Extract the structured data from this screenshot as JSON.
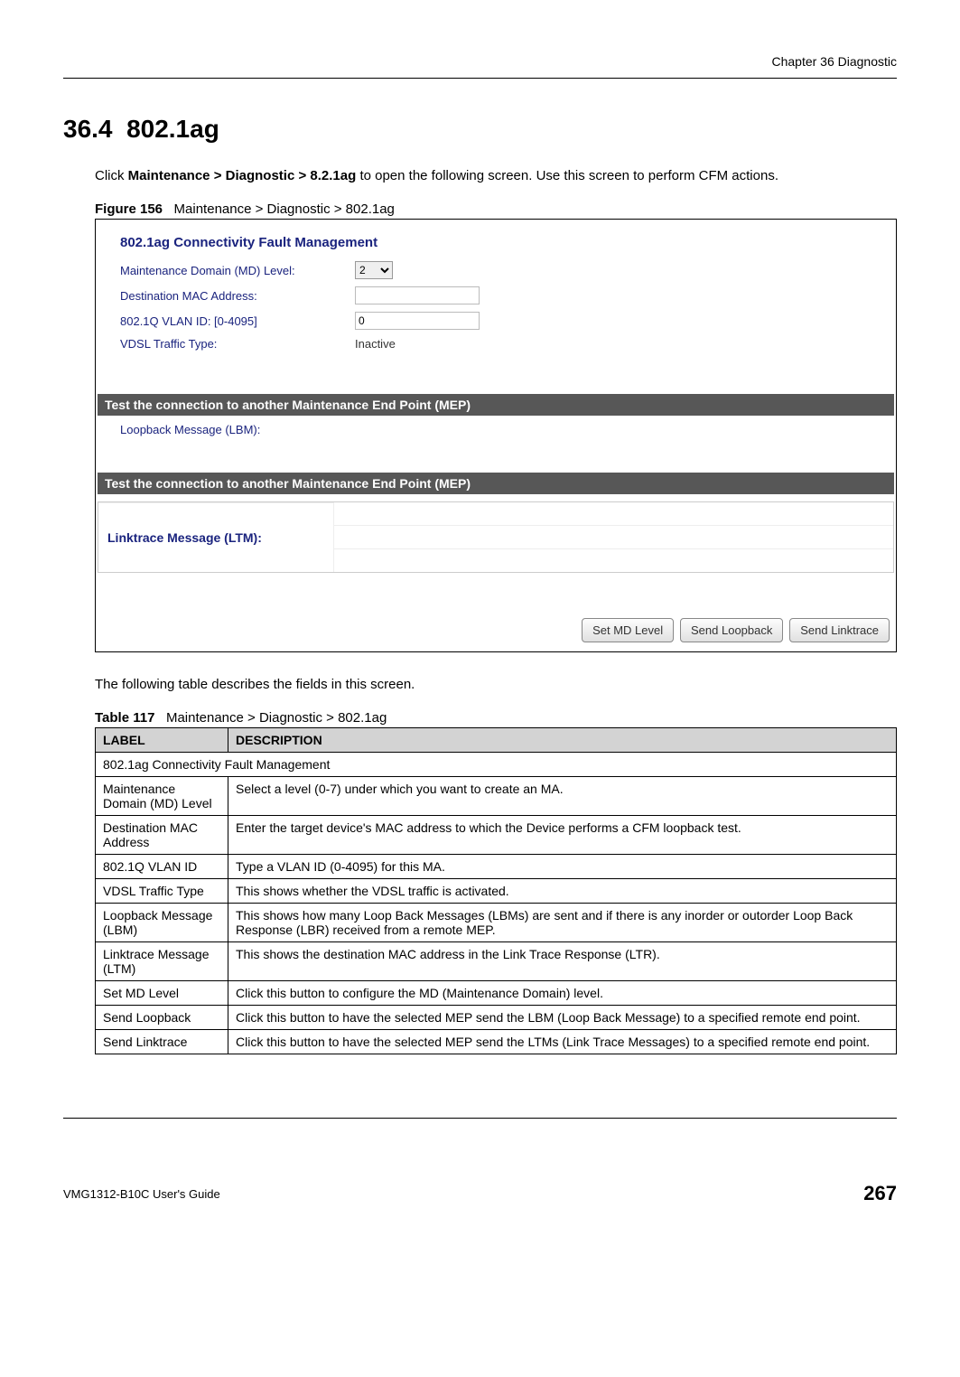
{
  "header": {
    "chapter": "Chapter 36 Diagnostic"
  },
  "section": {
    "number": "36.4",
    "title": "802.1ag"
  },
  "intro": {
    "prefix": "Click ",
    "path1": "Maintenance > ",
    "path2": "Diagnostic",
    "path3": " > 8.2.1ag",
    "suffix": " to open the following screen. Use this screen to perform CFM actions."
  },
  "figure": {
    "label": "Figure 156",
    "caption": "Maintenance > Diagnostic > 802.1ag"
  },
  "screenshot": {
    "panel_title": "802.1ag Connectivity Fault Management",
    "md_level_label": "Maintenance Domain (MD) Level:",
    "md_level_value": "2",
    "dest_mac_label": "Destination MAC Address:",
    "dest_mac_value": "",
    "vlan_label": "802.1Q VLAN ID: [0-4095]",
    "vlan_value": "0",
    "vdsl_label": "VDSL Traffic Type:",
    "vdsl_value": "Inactive",
    "banner1": "Test the connection to another Maintenance End Point (MEP)",
    "lbm_label": "Loopback Message (LBM):",
    "banner2": "Test the connection to another Maintenance End Point (MEP)",
    "ltm_label": "Linktrace Message (LTM):",
    "btn_md": "Set MD Level",
    "btn_loopback": "Send Loopback",
    "btn_linktrace": "Send Linktrace"
  },
  "post_figure_text": "The following table describes the fields in this screen.",
  "table": {
    "label": "Table 117",
    "caption": "Maintenance > Diagnostic > 802.1ag",
    "header_label": "LABEL",
    "header_desc": "DESCRIPTION",
    "rows": [
      {
        "label": "802.1ag Connectivity Fault Management",
        "desc": "",
        "span": true
      },
      {
        "label": "Maintenance Domain (MD) Level",
        "desc": "Select a level (0-7) under which you want to create an MA."
      },
      {
        "label": "Destination MAC Address",
        "desc": "Enter the target device's MAC address to which the Device performs a CFM loopback test."
      },
      {
        "label": "802.1Q VLAN ID",
        "desc": "Type a VLAN ID (0-4095) for this MA."
      },
      {
        "label": "VDSL Traffic Type",
        "desc": "This shows whether the VDSL traffic is activated."
      },
      {
        "label": "Loopback Message (LBM)",
        "desc": "This shows how many Loop Back Messages (LBMs) are sent and if there is any inorder or outorder Loop Back Response (LBR) received from a remote MEP."
      },
      {
        "label": "Linktrace Message (LTM)",
        "desc": "This shows the destination MAC address in the Link Trace Response (LTR)."
      },
      {
        "label": "Set MD Level",
        "desc": "Click this button to configure the MD (Maintenance Domain) level."
      },
      {
        "label": "Send Loopback",
        "desc": "Click this button to have the selected MEP send the LBM (Loop Back Message) to a specified remote end point."
      },
      {
        "label": "Send Linktrace",
        "desc": "Click this button to have the selected MEP send the LTMs (Link Trace Messages) to a specified remote end point."
      }
    ]
  },
  "footer": {
    "guide": "VMG1312-B10C User's Guide",
    "page": "267"
  }
}
